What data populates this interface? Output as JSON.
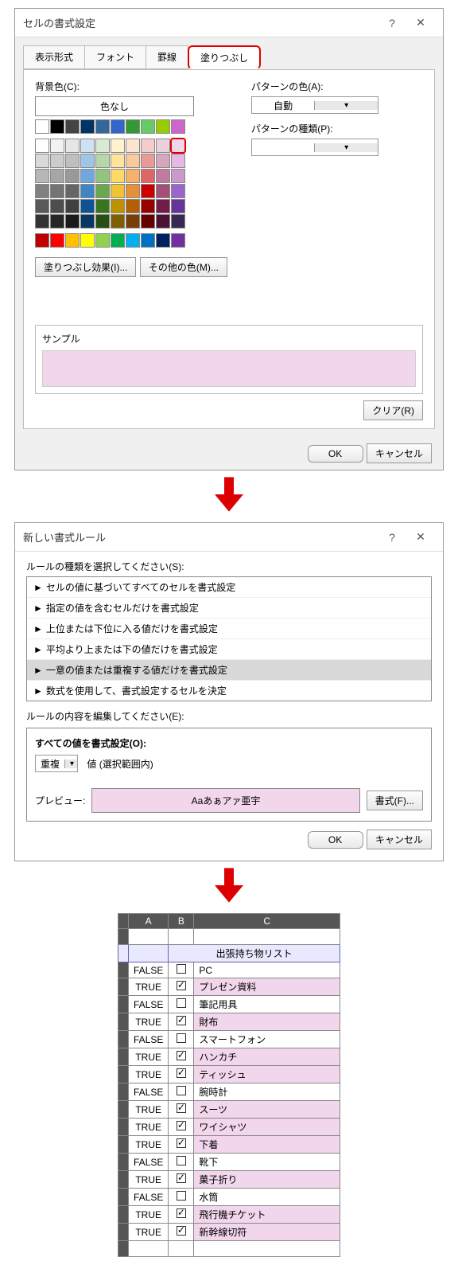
{
  "dialog1": {
    "title": "セルの書式設定",
    "tabs": [
      "表示形式",
      "フォント",
      "罫線",
      "塗りつぶし"
    ],
    "bgLabel": "背景色(C):",
    "noColor": "色なし",
    "patColorLabel": "パターンの色(A):",
    "patColorValue": "自動",
    "patTypeLabel": "パターンの種類(P):",
    "fillFx": "塗りつぶし効果(I)...",
    "moreColors": "その他の色(M)...",
    "sampleLabel": "サンプル",
    "clear": "クリア(R)",
    "ok": "OK",
    "cancel": "キャンセル",
    "paletteRow1": [
      "#ffffff",
      "#000000",
      "#444444",
      "#003366",
      "#336699",
      "#3366cc",
      "#339933",
      "#66cc66",
      "#99cc00",
      "#cc66cc"
    ],
    "paletteGrid": [
      [
        "#ffffff",
        "#f2f2f2",
        "#e6e6e6",
        "#cfe2f3",
        "#d9ead3",
        "#fff2cc",
        "#fce5cd",
        "#f4cccc",
        "#ead1dc",
        "#f2d6ec"
      ],
      [
        "#d9d9d9",
        "#cccccc",
        "#bfbfbf",
        "#9fc5e8",
        "#b6d7a8",
        "#ffe599",
        "#f9cb9c",
        "#ea9999",
        "#d5a6bd",
        "#e6b8e6"
      ],
      [
        "#b7b7b7",
        "#a6a6a6",
        "#999999",
        "#6fa8dc",
        "#93c47d",
        "#ffd966",
        "#f6b26b",
        "#e06666",
        "#c27ba0",
        "#cc99cc"
      ],
      [
        "#808080",
        "#737373",
        "#666666",
        "#3d85c6",
        "#6aa84f",
        "#f1c232",
        "#e69138",
        "#cc0000",
        "#a64d79",
        "#9966cc"
      ],
      [
        "#595959",
        "#4d4d4d",
        "#404040",
        "#0b5394",
        "#38761d",
        "#bf9000",
        "#b45f06",
        "#990000",
        "#741b47",
        "#663399"
      ],
      [
        "#333333",
        "#262626",
        "#1a1a1a",
        "#073763",
        "#274e13",
        "#7f6000",
        "#783f04",
        "#660000",
        "#4c1130",
        "#3a2754"
      ]
    ],
    "paletteBottom": [
      "#c00000",
      "#ff0000",
      "#ffc000",
      "#ffff00",
      "#92d050",
      "#00b050",
      "#00b0f0",
      "#0070c0",
      "#002060",
      "#7030a0"
    ]
  },
  "dialog2": {
    "title": "新しい書式ルール",
    "ruleTypeLabel": "ルールの種類を選択してください(S):",
    "rules": [
      "セルの値に基づいてすべてのセルを書式設定",
      "指定の値を含むセルだけを書式設定",
      "上位または下位に入る値だけを書式設定",
      "平均より上または下の値だけを書式設定",
      "一意の値または重複する値だけを書式設定",
      "数式を使用して、書式設定するセルを決定"
    ],
    "editLabel": "ルールの内容を編集してください(E):",
    "allValues": "すべての値を書式設定(O):",
    "dup": "重複",
    "dupHint": "値 (選択範囲内)",
    "previewLabel": "プレビュー:",
    "previewText": "Aaあぁアァ亜宇",
    "fmtBtn": "書式(F)...",
    "ok": "OK",
    "cancel": "キャンセル"
  },
  "sheet": {
    "cols": [
      "A",
      "B",
      "C"
    ],
    "header": "出張持ち物リスト",
    "rows": [
      {
        "a": "FALSE",
        "b": false,
        "c": "PC",
        "pink": false
      },
      {
        "a": "TRUE",
        "b": true,
        "c": "プレゼン資料",
        "pink": true
      },
      {
        "a": "FALSE",
        "b": false,
        "c": "筆記用具",
        "pink": false
      },
      {
        "a": "TRUE",
        "b": true,
        "c": "財布",
        "pink": true
      },
      {
        "a": "FALSE",
        "b": false,
        "c": "スマートフォン",
        "pink": false
      },
      {
        "a": "TRUE",
        "b": true,
        "c": "ハンカチ",
        "pink": true
      },
      {
        "a": "TRUE",
        "b": true,
        "c": "ティッシュ",
        "pink": true
      },
      {
        "a": "FALSE",
        "b": false,
        "c": "腕時計",
        "pink": false
      },
      {
        "a": "TRUE",
        "b": true,
        "c": "スーツ",
        "pink": true
      },
      {
        "a": "TRUE",
        "b": true,
        "c": "ワイシャツ",
        "pink": true
      },
      {
        "a": "TRUE",
        "b": true,
        "c": "下着",
        "pink": true
      },
      {
        "a": "FALSE",
        "b": false,
        "c": "靴下",
        "pink": false
      },
      {
        "a": "TRUE",
        "b": true,
        "c": "菓子折り",
        "pink": true
      },
      {
        "a": "FALSE",
        "b": false,
        "c": "水筒",
        "pink": false
      },
      {
        "a": "TRUE",
        "b": true,
        "c": "飛行機チケット",
        "pink": true
      },
      {
        "a": "TRUE",
        "b": true,
        "c": "新幹線切符",
        "pink": true
      }
    ]
  }
}
